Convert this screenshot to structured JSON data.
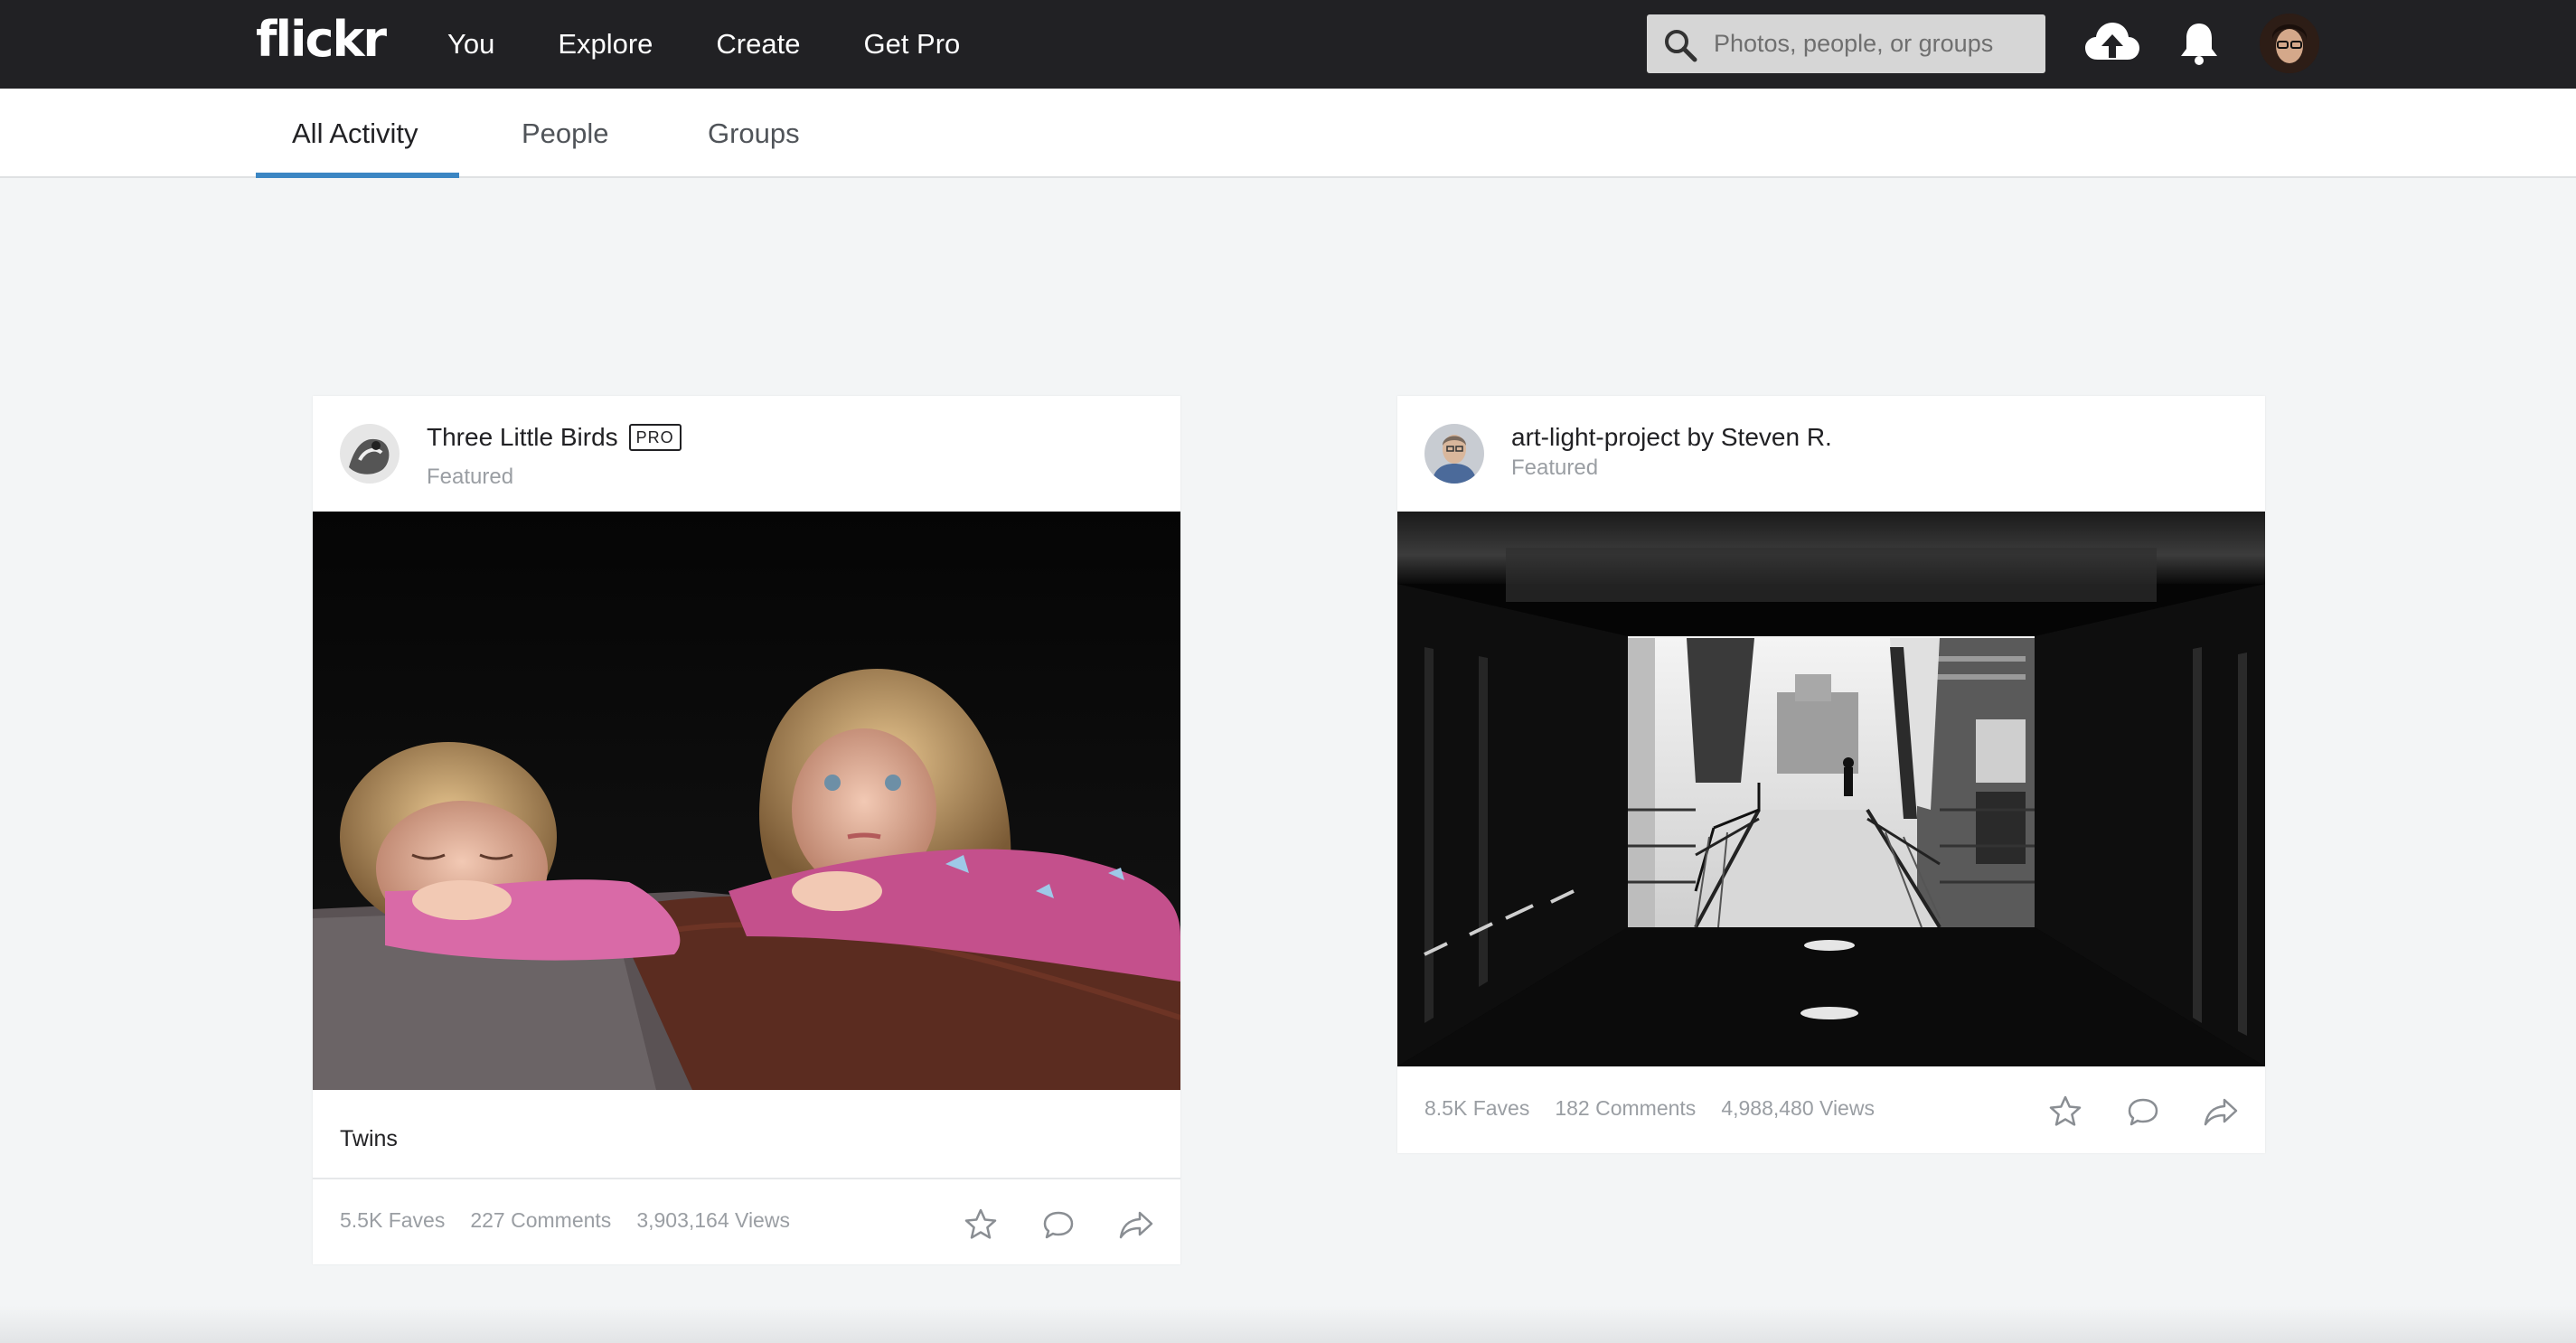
{
  "app": {
    "logo": "flickr"
  },
  "nav": {
    "items": [
      {
        "label": "You"
      },
      {
        "label": "Explore"
      },
      {
        "label": "Create"
      },
      {
        "label": "Get Pro"
      }
    ],
    "search_placeholder": "Photos, people, or groups",
    "icons": [
      "search-icon",
      "upload-cloud-icon",
      "bell-icon",
      "user-avatar"
    ]
  },
  "subnav": {
    "tabs": [
      {
        "label": "All Activity",
        "active": true
      },
      {
        "label": "People",
        "active": false
      },
      {
        "label": "Groups",
        "active": false
      }
    ]
  },
  "colors": {
    "topbar": "#212124",
    "accent": "#3b86c3",
    "background": "#f3f5f6"
  },
  "cards": [
    {
      "author": "Three Little Birds",
      "badge": "PRO",
      "tag": "Featured",
      "caption": "Twins",
      "faves": "5.5K Faves",
      "comments": "227 Comments",
      "views": "3,903,164 Views"
    },
    {
      "author": "art-light-project by Steven R.",
      "tag": "Featured",
      "faves": "8.5K Faves",
      "comments": "182 Comments",
      "views": "4,988,480 Views"
    }
  ]
}
